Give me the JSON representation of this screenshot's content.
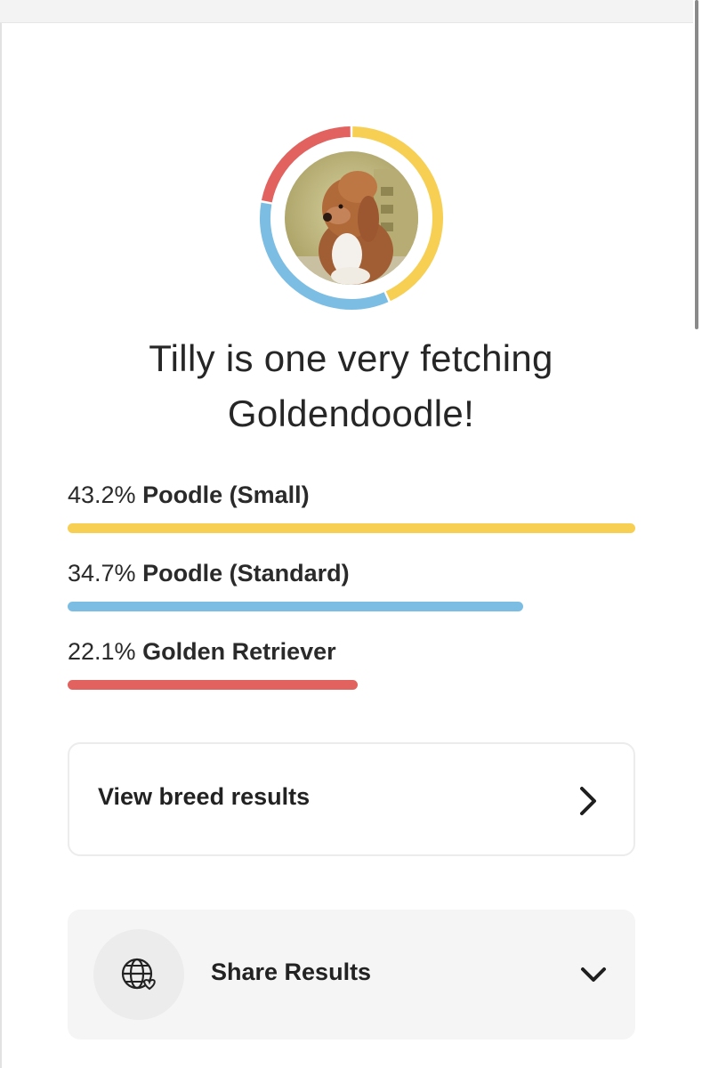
{
  "headline": "Tilly is one very fetching Goldendoodle!",
  "breeds": [
    {
      "percent": "43.2%",
      "name": "Poodle (Small)",
      "value": 43.2,
      "color": "#f6cf53"
    },
    {
      "percent": "34.7%",
      "name": "Poodle (Standard)",
      "value": 34.7,
      "color": "#7cbde4"
    },
    {
      "percent": "22.1%",
      "name": "Golden Retriever",
      "value": 22.1,
      "color": "#e1625e"
    }
  ],
  "view_breed_results": {
    "label": "View breed results",
    "icon": "chevron-right-icon"
  },
  "share": {
    "label": "Share Results",
    "icon": "globe-heart-icon",
    "toggle_icon": "chevron-down-icon"
  },
  "colors": {
    "small_poodle": "#f6cf53",
    "standard_poodle": "#7cbde4",
    "golden_retriever": "#e1625e"
  }
}
